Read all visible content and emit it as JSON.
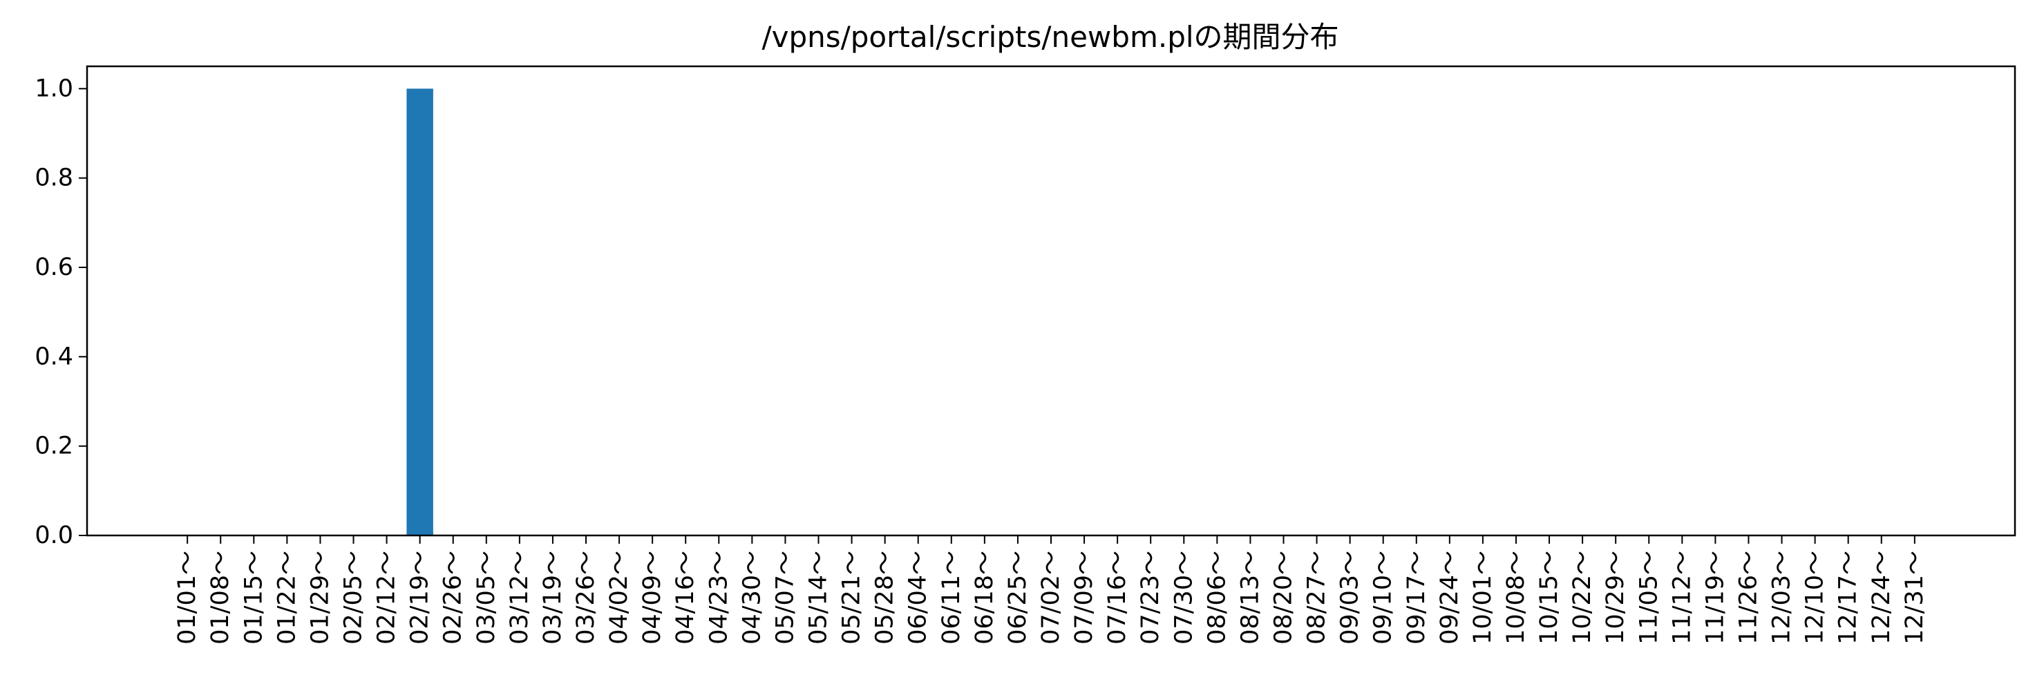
{
  "chart_data": {
    "type": "bar",
    "title": "/vpns/portal/scripts/newbm.plの期間分布",
    "xlabel": "",
    "ylabel": "",
    "categories": [
      "01/01～",
      "01/08～",
      "01/15～",
      "01/22～",
      "01/29～",
      "02/05～",
      "02/12～",
      "02/19～",
      "02/26～",
      "03/05～",
      "03/12～",
      "03/19～",
      "03/26～",
      "04/02～",
      "04/09～",
      "04/16～",
      "04/23～",
      "04/30～",
      "05/07～",
      "05/14～",
      "05/21～",
      "05/28～",
      "06/04～",
      "06/11～",
      "06/18～",
      "06/25～",
      "07/02～",
      "07/09～",
      "07/16～",
      "07/23～",
      "07/30～",
      "08/06～",
      "08/13～",
      "08/20～",
      "08/27～",
      "09/03～",
      "09/10～",
      "09/17～",
      "09/24～",
      "10/01～",
      "10/08～",
      "10/15～",
      "10/22～",
      "10/29～",
      "11/05～",
      "11/12～",
      "11/19～",
      "11/26～",
      "12/03～",
      "12/10～",
      "12/17～",
      "12/24～",
      "12/31～"
    ],
    "values": [
      0,
      0,
      0,
      0,
      0,
      0,
      0,
      1,
      0,
      0,
      0,
      0,
      0,
      0,
      0,
      0,
      0,
      0,
      0,
      0,
      0,
      0,
      0,
      0,
      0,
      0,
      0,
      0,
      0,
      0,
      0,
      0,
      0,
      0,
      0,
      0,
      0,
      0,
      0,
      0,
      0,
      0,
      0,
      0,
      0,
      0,
      0,
      0,
      0,
      0,
      0,
      0,
      0
    ],
    "ylim": [
      0,
      1.05
    ],
    "yticks": [
      "0.0",
      "0.2",
      "0.4",
      "0.6",
      "0.8",
      "1.0"
    ],
    "grid": false,
    "bar_color": "#1f77b4"
  }
}
